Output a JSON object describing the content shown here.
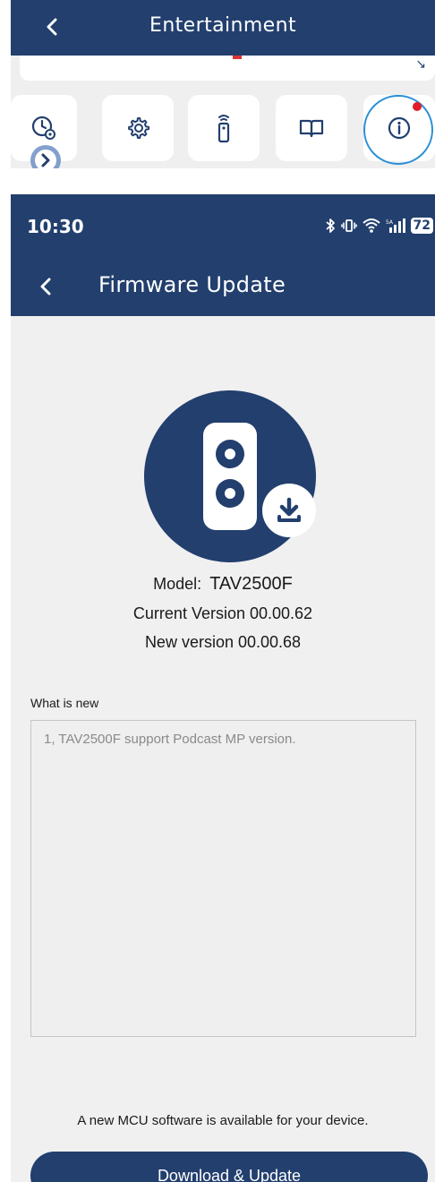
{
  "top_panel": {
    "title": "Entertainment",
    "tools": [
      {
        "icon": "timer-settings-icon"
      },
      {
        "icon": "gear-icon"
      },
      {
        "icon": "remote-control-icon"
      },
      {
        "icon": "book-icon"
      },
      {
        "icon": "info-icon"
      }
    ],
    "info_notification": true,
    "highlight_color": "#2a8fd6",
    "notification_color": "#e11d2a"
  },
  "status_bar": {
    "time": "10:30",
    "icons": [
      "bluetooth-icon",
      "vibrate-icon",
      "wifi-icon",
      "signal-5g-icon",
      "battery-icon"
    ],
    "battery": "72"
  },
  "nav": {
    "title": "Firmware Update"
  },
  "firmware": {
    "model_label": "Model:",
    "model_value": "TAV2500F",
    "current_version": "Current Version 00.00.62",
    "new_version": "New version 00.00.68"
  },
  "whats_new": {
    "label": "What is new",
    "text": "1, TAV2500F support Podcast MP version."
  },
  "footer": {
    "notice": "A new MCU software is available for your device.",
    "button": "Download & Update"
  },
  "colors": {
    "brand": "#223f6e",
    "background": "#f0f0f0"
  }
}
